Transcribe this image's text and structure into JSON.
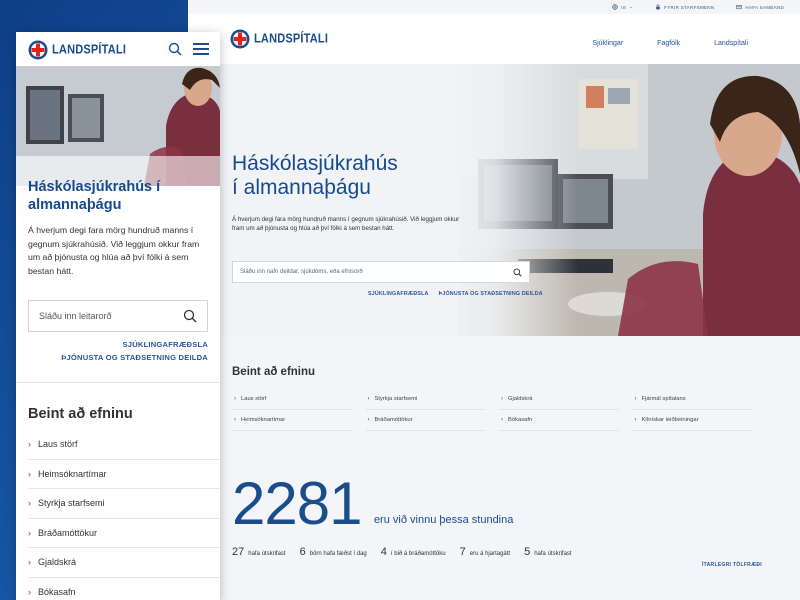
{
  "brand": {
    "name": "LANDSPÍTALI",
    "colors": {
      "primary": "#1a4d8c",
      "accent": "#e2231a",
      "background": "#f3f5f8"
    }
  },
  "desktop": {
    "topbar": {
      "language": "IS",
      "for_staff": "FYRIR STARFSMENN",
      "contact": "HAFA SAMBAND"
    },
    "nav": [
      "Sjúklingar",
      "Fagfólk",
      "Landspítali"
    ],
    "hero": {
      "title_line1": "Háskólasjúkrahús",
      "title_line2": "í almannaþágu",
      "text": "Á hverjum degi fara mörg hundruð manns í gegnum sjúkrahúsið. Við leggjum okkur fram um að þjónusta og hlúa að því fólki á sem bestan hátt.",
      "search_placeholder": "Sláðu inn nafn deildar, sjúkdóms, eða efnisorð",
      "link1": "SJÚKLINGAFRÆÐSLA",
      "link2": "ÞJÓNUSTA OG STAÐSETNING DEILDA"
    },
    "direct": {
      "heading": "Beint að efninu",
      "columns": [
        [
          "Laus störf",
          "Heimsóknartímar"
        ],
        [
          "Styrkja starfsemi",
          "Bráðamóttökur"
        ],
        [
          "Gjaldskrá",
          "Bókasafn"
        ],
        [
          "Fjármál spítalans",
          "Klínískar leiðbeiningar"
        ]
      ]
    },
    "stats": {
      "big_number": "2281",
      "big_label": "eru við vinnu þessa stundina",
      "items": [
        {
          "num": "27",
          "label": "hafa útskrifast"
        },
        {
          "num": "6",
          "label": "börn hafa fæðst í dag"
        },
        {
          "num": "4",
          "label": "í bið á bráðamóttöku"
        },
        {
          "num": "7",
          "label": "eru á hjartagátt"
        },
        {
          "num": "5",
          "label": "hafa útskrifast"
        }
      ],
      "more_link": "ÍTARLEGRI TÖLFRÆÐI"
    }
  },
  "mobile": {
    "hero": {
      "title_line1": "Háskólasjúkrahús í",
      "title_line2": "almannaþágu",
      "text": "Á hverjum degi fara mörg hundruð manns í gegnum sjúkrahúsið. Við leggjum okkur fram um að þjónusta og hlúa að því fólki á sem bestan hátt.",
      "search_placeholder": "Sláðu inn leitarorð",
      "link1": "SJÚKLINGAFRÆÐSLA",
      "link2": "ÞJÓNUSTA OG STAÐSETNING DEILDA"
    },
    "direct": {
      "heading": "Beint að efninu",
      "items": [
        "Laus störf",
        "Heimsóknartímar",
        "Styrkja starfsemi",
        "Bráðamóttökur",
        "Gjaldskrá",
        "Bókasafn"
      ]
    }
  },
  "icons": {
    "search": "search-icon",
    "menu": "hamburger-menu-icon",
    "globe": "globe-icon",
    "staff": "lock-icon",
    "contact": "mail-icon",
    "chevron": "chevron-right-icon"
  }
}
